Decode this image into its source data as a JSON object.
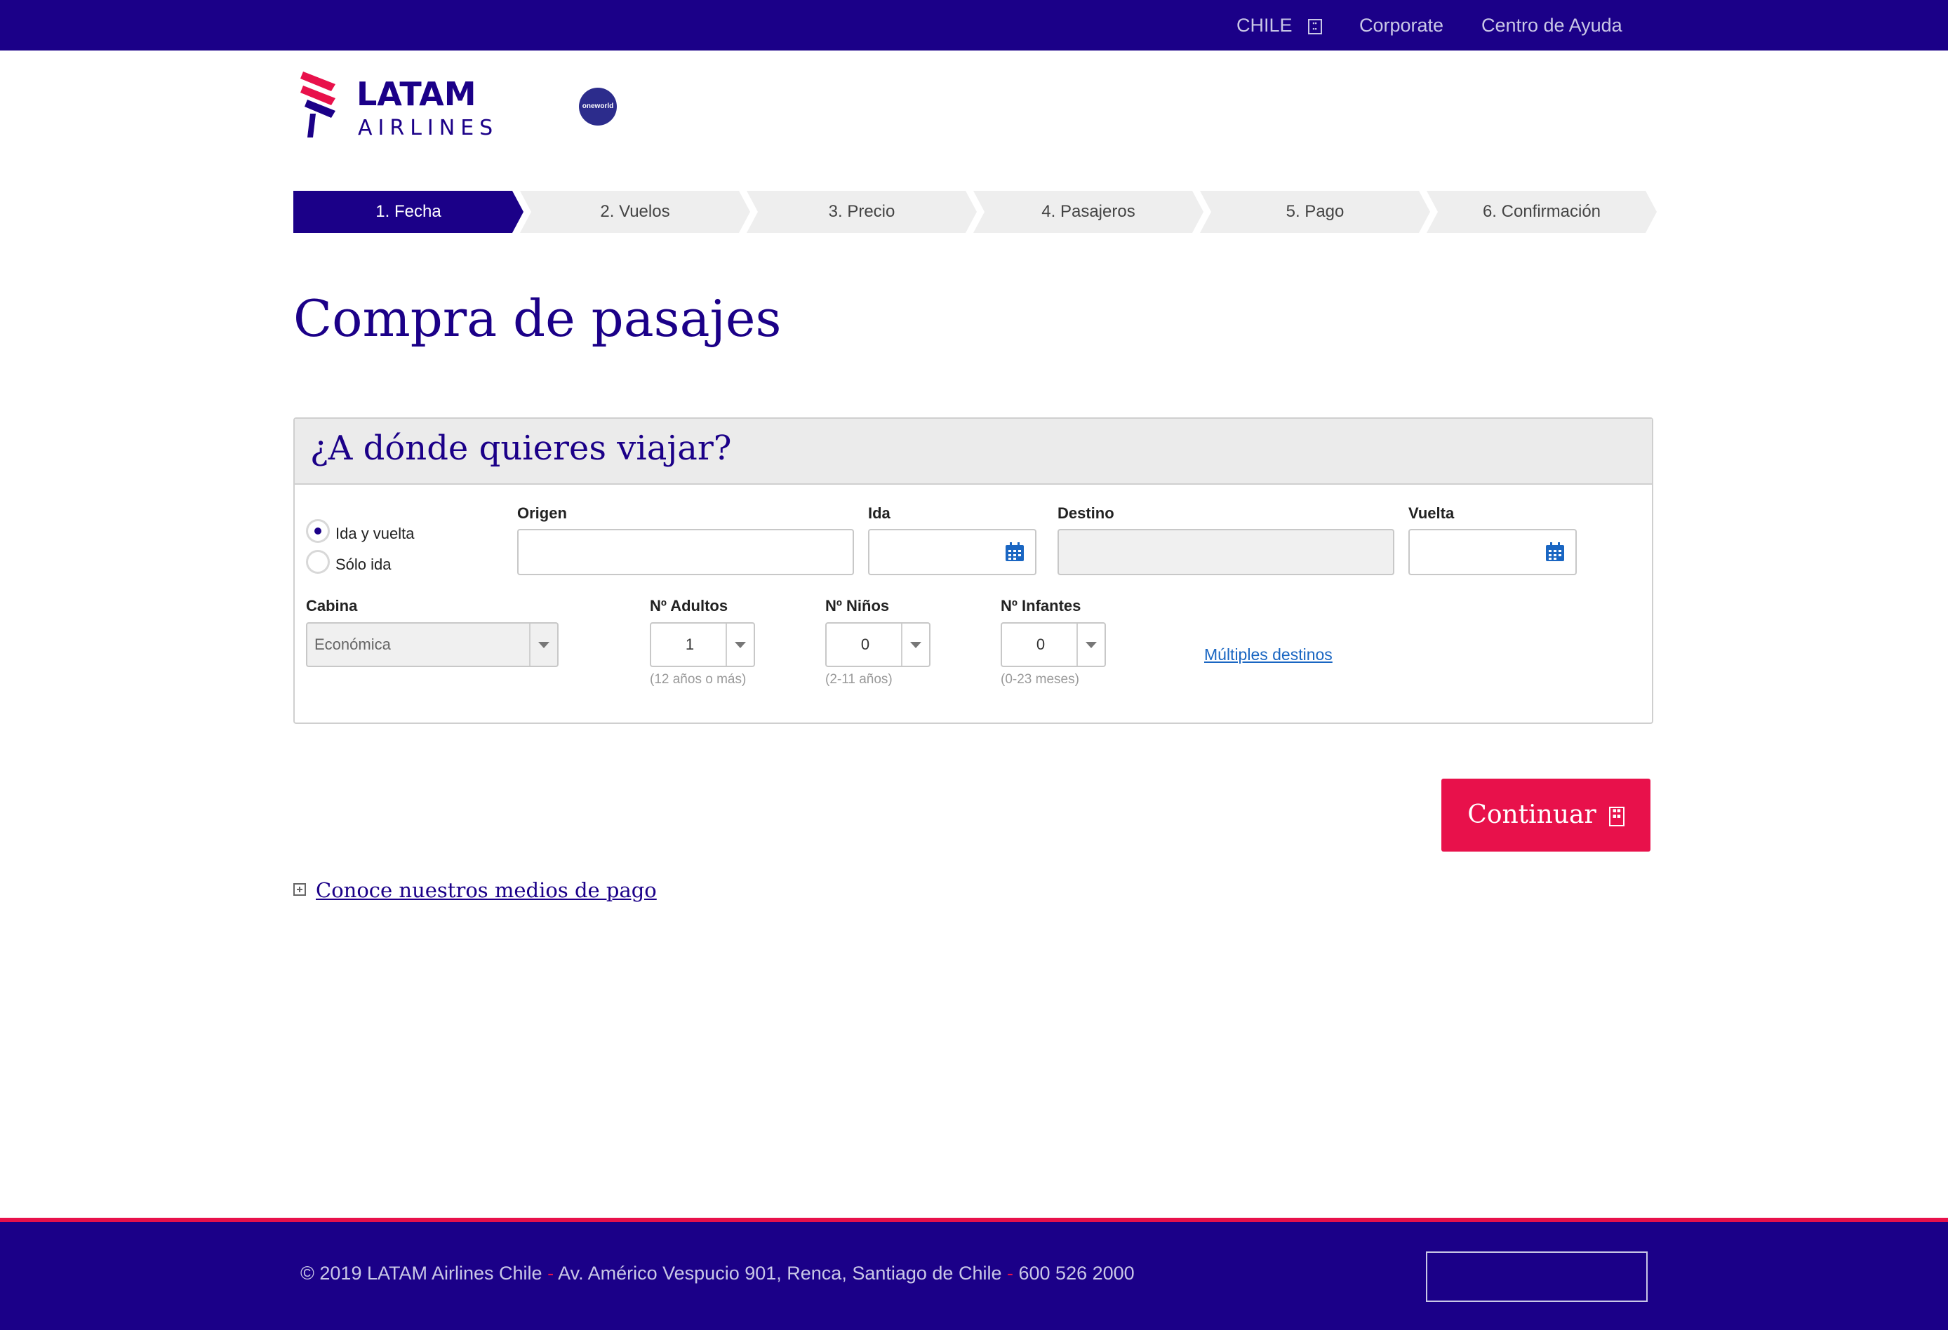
{
  "topbar": {
    "country": "CHILE",
    "corporate": "Corporate",
    "help": "Centro de Ayuda"
  },
  "brand": {
    "name": "LATAM",
    "sub": "AIRLINES",
    "alliance": "oneworld",
    "colors": {
      "primary": "#1b0088",
      "accent": "#e8114b"
    }
  },
  "steps": [
    "1. Fecha",
    "2. Vuelos",
    "3. Precio",
    "4. Pasajeros",
    "5. Pago",
    "6. Confirmación"
  ],
  "page_title": "Compra de pasajes",
  "search": {
    "title": "¿A dónde quieres viajar?",
    "trip_type": {
      "round_trip": "Ida y vuelta",
      "one_way": "Sólo ida",
      "selected": "Ida y vuelta"
    },
    "origin_label": "Origen",
    "origin_value": "",
    "departure_label": "Ida",
    "departure_value": "",
    "destination_label": "Destino",
    "destination_value": "",
    "return_label": "Vuelta",
    "return_value": "",
    "cabin_label": "Cabina",
    "cabin_value": "Económica",
    "adults_label": "Nº Adultos",
    "adults_value": "1",
    "adults_hint": "(12 años o más)",
    "children_label": "Nº Niños",
    "children_value": "0",
    "children_hint": "(2-11 años)",
    "infants_label": "Nº Infantes",
    "infants_value": "0",
    "infants_hint": "(0-23 meses)",
    "multi_destinations": "Múltiples destinos"
  },
  "continue_button": "Continuar",
  "payment_link": "Conoce nuestros medios de pago",
  "footer": {
    "copyright": "© 2019 LATAM Airlines Chile",
    "address": "Av. Américo Vespucio 901, Renca, Santiago de Chile",
    "phone": "600 526 2000",
    "separator": "-"
  }
}
